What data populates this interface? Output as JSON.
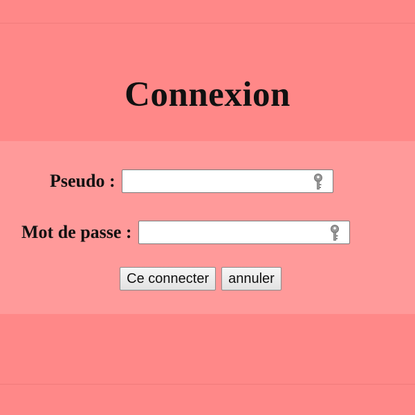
{
  "page": {
    "title": "Connexion"
  },
  "form": {
    "pseudo_label": "Pseudo :",
    "pseudo_value": "",
    "password_label": "Mot de passe :",
    "password_value": "",
    "field_icon": "key-icon",
    "submit_label": "Ce connecter",
    "cancel_label": "annuler"
  },
  "colors": {
    "page_background": "#ff8888",
    "form_background": "#ff9a9a",
    "text": "#111111"
  }
}
